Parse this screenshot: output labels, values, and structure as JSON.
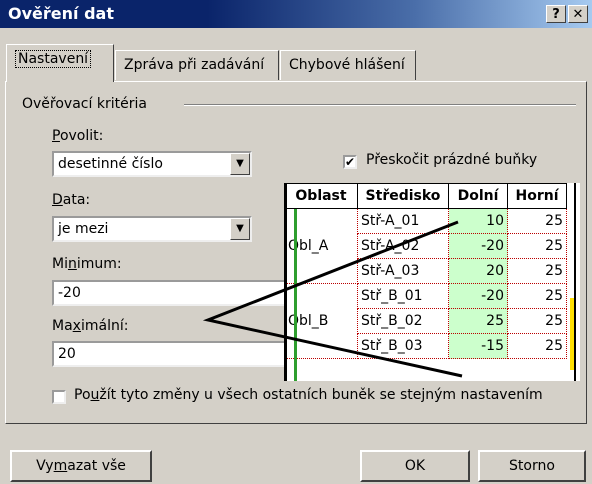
{
  "window": {
    "title": "Ověření dat",
    "help_label": "?",
    "close_label": "✕"
  },
  "tabs": [
    {
      "label": "Nastavení",
      "active": true
    },
    {
      "label": "Zpráva při zadávání",
      "active": false
    },
    {
      "label": "Chybové hlášení",
      "active": false
    }
  ],
  "criteria": {
    "group_label": "Ověřovací kritéria",
    "allow_label": "Povolit:",
    "allow_value": "desetinné číslo",
    "ignore_blank_label": "Přeskočit prázdné buňky",
    "ignore_blank_checked": true,
    "data_label": "Data:",
    "data_value": "je mezi",
    "minimum_label": "Minimum:",
    "minimum_value": "-20",
    "maximum_label": "Maximální:",
    "maximum_value": "20",
    "apply_all_label": "Použít tyto změny u všech ostatních buněk se stejným nastavením",
    "apply_all_checked": false
  },
  "buttons": {
    "clear": "Vymazat vše",
    "ok": "OK",
    "cancel": "Storno"
  },
  "sheet": {
    "headers": [
      "Oblast",
      "Středisko",
      "Dolní",
      "Horní"
    ],
    "groups": [
      {
        "area": "Obl_A",
        "rows": [
          {
            "center": "Stř-A_01",
            "low": "10",
            "high": "25"
          },
          {
            "center": "Stř-A_02",
            "low": "-20",
            "high": "25"
          },
          {
            "center": "Stř-A_03",
            "low": "20",
            "high": "25"
          }
        ]
      },
      {
        "area": "Obl_B",
        "rows": [
          {
            "center": "Stř_B_01",
            "low": "-20",
            "high": "25"
          },
          {
            "center": "Stř_B_02",
            "low": "25",
            "high": "25"
          },
          {
            "center": "Stř_B_03",
            "low": "-15",
            "high": "25"
          }
        ]
      }
    ]
  }
}
